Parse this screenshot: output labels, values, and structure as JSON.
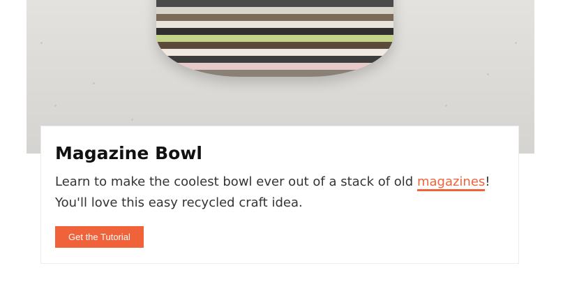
{
  "card": {
    "title": "Magazine Bowl",
    "desc_before": "Learn to make the coolest bowl ever out of a stack of old ",
    "desc_link": "magazines",
    "desc_after": "! You'll love this easy recycled craft idea.",
    "button_label": "Get the Tutorial"
  },
  "colors": {
    "accent": "#f0623a",
    "heading": "#111111",
    "body_text": "#333333"
  }
}
